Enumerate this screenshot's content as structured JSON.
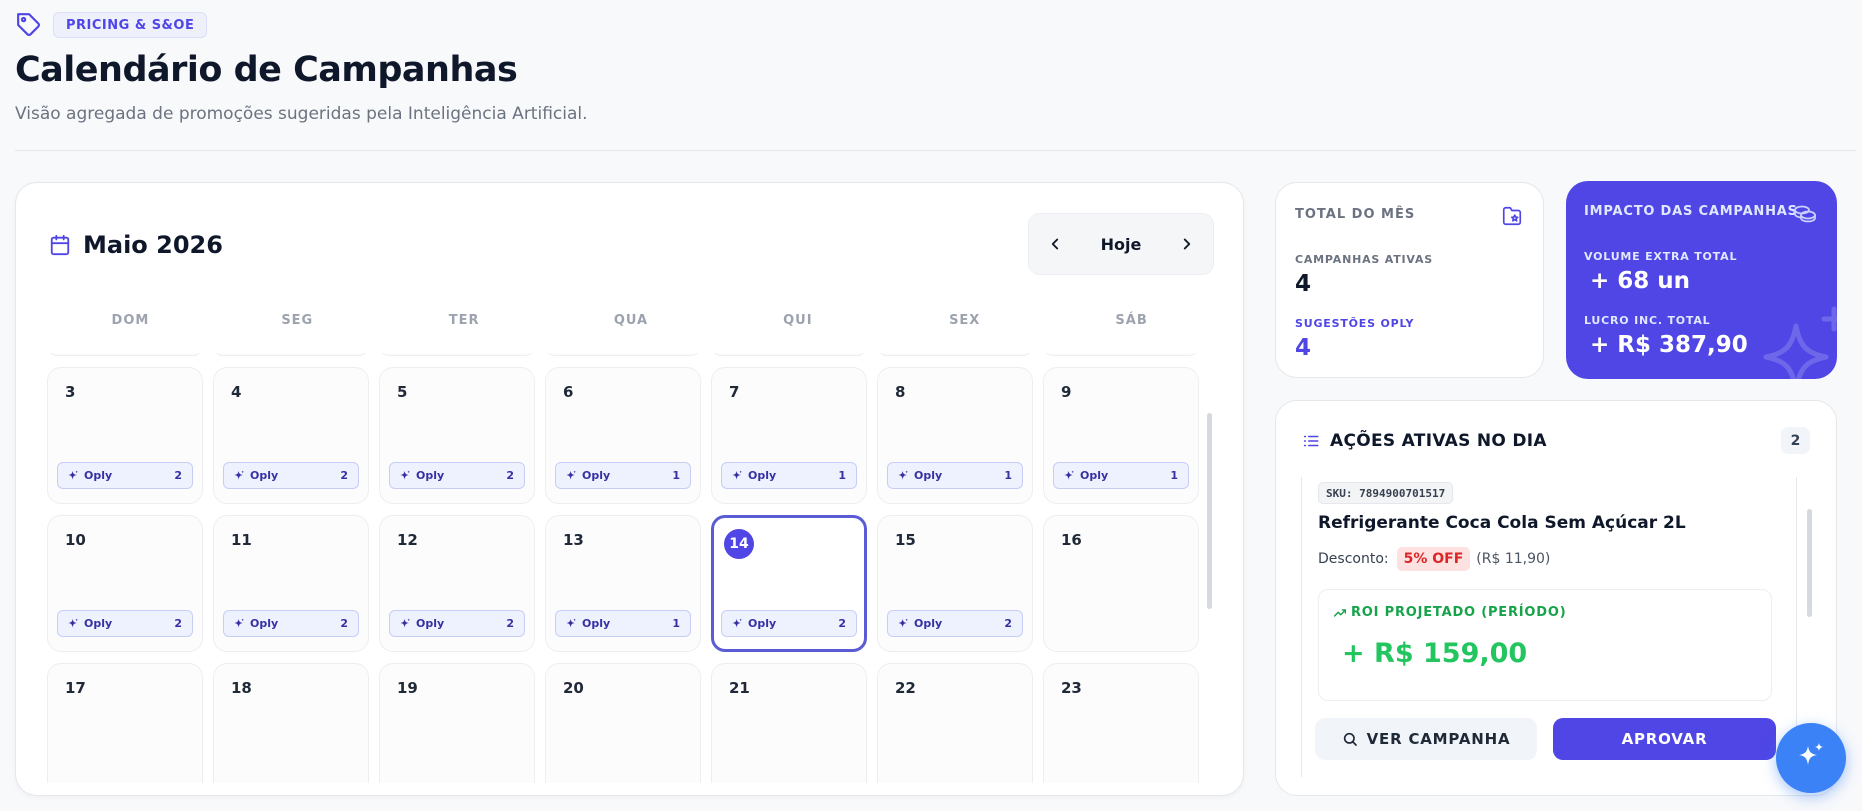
{
  "header": {
    "tag_label": "PRICING & S&OE",
    "title": "Calendário de Campanhas",
    "subtitle": "Visão agregada de promoções sugeridas pela Inteligência Artificial."
  },
  "calendar": {
    "month_label": "Maio 2026",
    "today_label": "Hoje",
    "weekdays": [
      "DOM",
      "SEG",
      "TER",
      "QUA",
      "QUI",
      "SEX",
      "SÁB"
    ],
    "pill_label": "Oply",
    "days": [
      {
        "day": "3",
        "count": "2"
      },
      {
        "day": "4",
        "count": "2"
      },
      {
        "day": "5",
        "count": "2"
      },
      {
        "day": "6",
        "count": "1"
      },
      {
        "day": "7",
        "count": "1"
      },
      {
        "day": "8",
        "count": "1"
      },
      {
        "day": "9",
        "count": "1"
      },
      {
        "day": "10",
        "count": "2"
      },
      {
        "day": "11",
        "count": "2"
      },
      {
        "day": "12",
        "count": "2"
      },
      {
        "day": "13",
        "count": "1"
      },
      {
        "day": "14",
        "count": "2",
        "today": true
      },
      {
        "day": "15",
        "count": "2"
      },
      {
        "day": "16",
        "count": ""
      },
      {
        "day": "17",
        "count": ""
      },
      {
        "day": "18",
        "count": ""
      },
      {
        "day": "19",
        "count": ""
      },
      {
        "day": "20",
        "count": ""
      },
      {
        "day": "21",
        "count": ""
      },
      {
        "day": "22",
        "count": ""
      },
      {
        "day": "23",
        "count": ""
      }
    ]
  },
  "stats": {
    "title": "TOTAL DO MÊS",
    "active_label": "CAMPANHAS ATIVAS",
    "active_value": "4",
    "suggest_label": "SUGESTÕES OPLY",
    "suggest_value": "4",
    "icon": "folder-star-icon"
  },
  "impact": {
    "title": "IMPACTO DAS CAMPANHAS",
    "volume_label": "VOLUME EXTRA TOTAL",
    "volume_value": "+ 68 un",
    "profit_label": "LUCRO INC. TOTAL",
    "profit_value": "+ R$ 387,90",
    "icon": "coins-icon"
  },
  "actions": {
    "title": "AÇÕES ATIVAS NO DIA",
    "count": "2",
    "item": {
      "sku": "SKU: 7894900701517",
      "name": "Refrigerante Coca Cola Sem Açúcar 2L",
      "discount_label": "Desconto:",
      "discount_badge": "5% OFF",
      "old_price": "(R$ 11,90)",
      "roi_label": "ROI PROJETADO (PERÍODO)",
      "roi_value": "+ R$ 159,00"
    },
    "view_button": "VER CAMPANHA",
    "approve_button": "APROVAR"
  },
  "colors": {
    "accent": "#4f46e5",
    "positive": "#22c55e",
    "danger": "#dc2626",
    "fab": "#3b82f6"
  }
}
